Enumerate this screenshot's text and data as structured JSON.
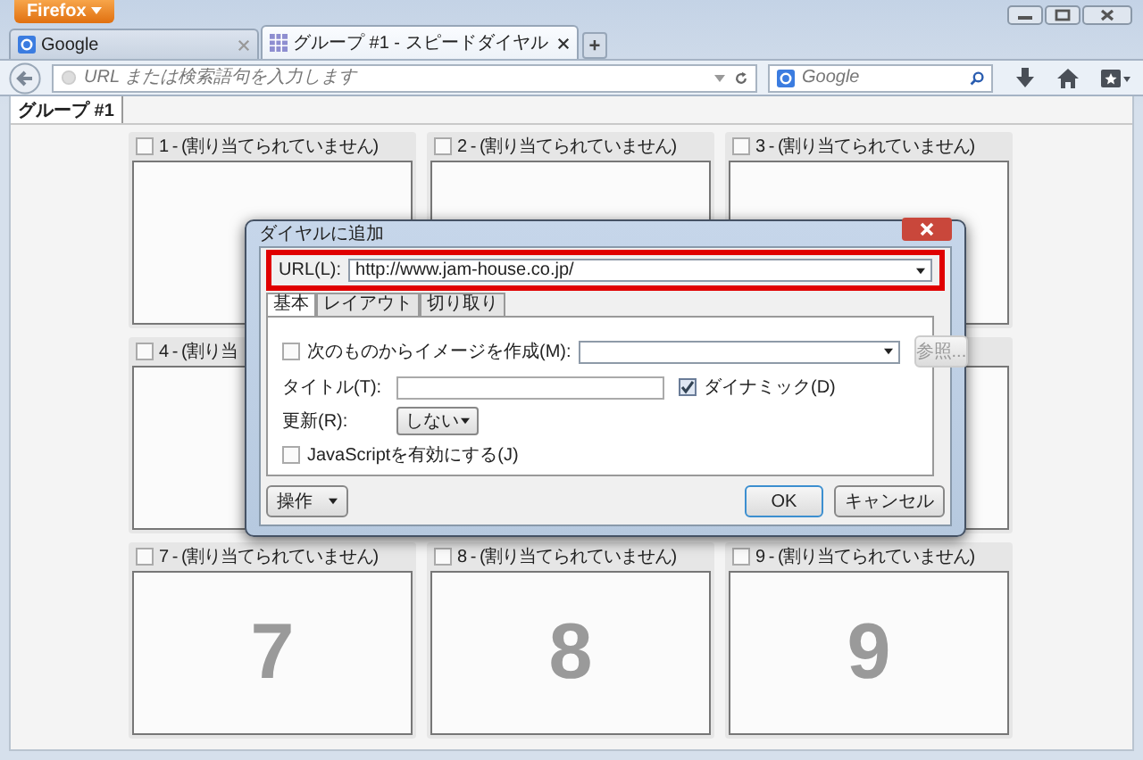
{
  "browser": {
    "menu_button": "Firefox",
    "tabs": [
      {
        "title": "Google",
        "kind": "search",
        "selected": false
      },
      {
        "title": "グループ #1 - スピードダイヤル",
        "kind": "speeddial",
        "selected": true
      }
    ],
    "new_tab": "+",
    "address_bar": {
      "placeholder": "URL または検索語句を入力します"
    },
    "search_bar": {
      "placeholder": "Google"
    }
  },
  "page": {
    "group_tabs": [
      {
        "label": "グループ #1",
        "selected": true
      }
    ],
    "dial_rows": [
      [
        {
          "label": "1 - (割り当てられていません)",
          "checked": false
        },
        {
          "label": "2 - (割り当てられていません)",
          "checked": false
        },
        {
          "label": "3 - (割り当てられていません)",
          "checked": false
        }
      ],
      [
        {
          "label": "4 - (割り当",
          "checked": false
        }
      ],
      [
        {
          "label": "7 - (割り当てられていません)",
          "checked": false,
          "number": "7"
        },
        {
          "label": "8 - (割り当てられていません)",
          "checked": false,
          "number": "8"
        },
        {
          "label": "9 - (割り当てられていません)",
          "checked": false,
          "number": "9"
        }
      ]
    ]
  },
  "dialog": {
    "title": "ダイヤルに追加",
    "url": {
      "label": "URL(L):",
      "value": "http://www.jam-house.co.jp/",
      "highlighted": true
    },
    "tabs": [
      {
        "label": "基本",
        "selected": true
      },
      {
        "label": "レイアウト",
        "selected": false
      },
      {
        "label": "切り取り",
        "selected": false
      }
    ],
    "image_source": {
      "label": "次のものからイメージを作成(M):",
      "checked": false
    },
    "browse_button": {
      "label": "参照...",
      "disabled": true
    },
    "title_field": {
      "label": "タイトル(T):"
    },
    "dynamic": {
      "label": "ダイナミック(D)",
      "checked": true
    },
    "refresh": {
      "label": "更新(R):",
      "value": "しない"
    },
    "javascript": {
      "label": "JavaScriptを有効にする(J)",
      "checked": false
    },
    "actions_button": "操作",
    "ok_button": "OK",
    "cancel_button": "キャンセル"
  }
}
